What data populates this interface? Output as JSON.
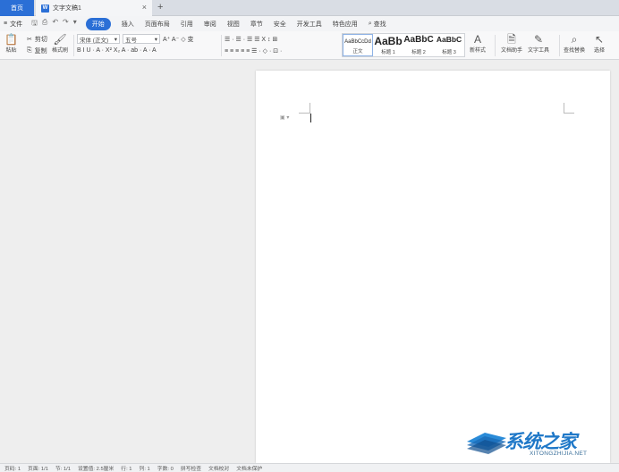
{
  "tabs": {
    "home": "首页",
    "doc": "文字文稿1",
    "close": "×",
    "new": "+"
  },
  "menu": {
    "file": "文件",
    "quick_icons": [
      "⎙",
      "↶",
      "↷",
      "▾"
    ],
    "items": [
      "开始",
      "插入",
      "页面布局",
      "引用",
      "审阅",
      "视图",
      "章节",
      "安全",
      "开发工具",
      "特色应用"
    ],
    "active_index": 0,
    "search": "查找"
  },
  "ribbon": {
    "paste": "粘贴",
    "cut": "剪切",
    "copy": "复制",
    "format_painter": "格式刷",
    "font_name": "宋体 (正文)",
    "font_size": "五号",
    "font_row1_tools": "A⁺ A⁻ ◇ 变",
    "font_row2_tools": "B  I  U ·  A ·  X²  X₂  A ·  ab ·  A ·  A",
    "para_row1_tools": "☰ · ☰ ·  ☰  ☰  X  ↕  ⊞",
    "para_row2_tools": "≡  ≡  ≡  ≡  ≡  ☰ ·  ◇ ·  ⊡ ·",
    "styles": [
      {
        "preview": "AaBbCcDd",
        "name": "正文"
      },
      {
        "preview": "AaBb",
        "name": "标题 1"
      },
      {
        "preview": "AaBbC",
        "name": "标题 2"
      },
      {
        "preview": "AaBbC",
        "name": "标题 3"
      }
    ],
    "new_style": "新样式",
    "text_assistant": "文档助手",
    "text_tools": "文字工具",
    "find_replace": "查找替换",
    "select": "选择"
  },
  "document": {
    "paragraph_mark": "▣ ▾"
  },
  "watermark": {
    "big": "系统之家",
    "small": "XITONGZHIJIA.NET"
  },
  "status": {
    "items": [
      "页码: 1",
      "页面: 1/1",
      "节: 1/1",
      "设置值: 2.5厘米",
      "行: 1",
      "列: 1",
      "字数: 0",
      "拼写检查",
      "文档校对",
      "文档未保护"
    ]
  },
  "colors": {
    "accent": "#2b6fd6",
    "background": "#efefef",
    "page": "#ffffff"
  }
}
